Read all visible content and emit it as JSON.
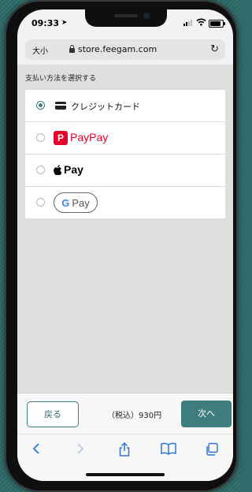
{
  "status": {
    "time": "09:33"
  },
  "browser": {
    "text_size_label": "大小",
    "url": "store.feegam.com"
  },
  "page": {
    "heading": "支払い方法を選択する",
    "payment_options": [
      {
        "label": "クレジットカード",
        "selected": true,
        "icon": "credit-card-icon"
      },
      {
        "label": "PayPay",
        "selected": false,
        "icon": "paypay-logo"
      },
      {
        "label": "Pay",
        "selected": false,
        "icon": "apple-logo"
      },
      {
        "label": "Pay",
        "selected": false,
        "icon": "google-g-logo",
        "g": "G"
      }
    ]
  },
  "footer": {
    "back_label": "戻る",
    "total": "（税込）930円",
    "next_label": "次へ"
  },
  "toolbar": {
    "icons": [
      "back-arrow-icon",
      "forward-arrow-icon",
      "share-icon",
      "bookmarks-icon",
      "tabs-icon"
    ]
  },
  "colors": {
    "accent": "#3d7d7d",
    "paypay_red": "#e5002b",
    "link_blue": "#2f76d8"
  }
}
